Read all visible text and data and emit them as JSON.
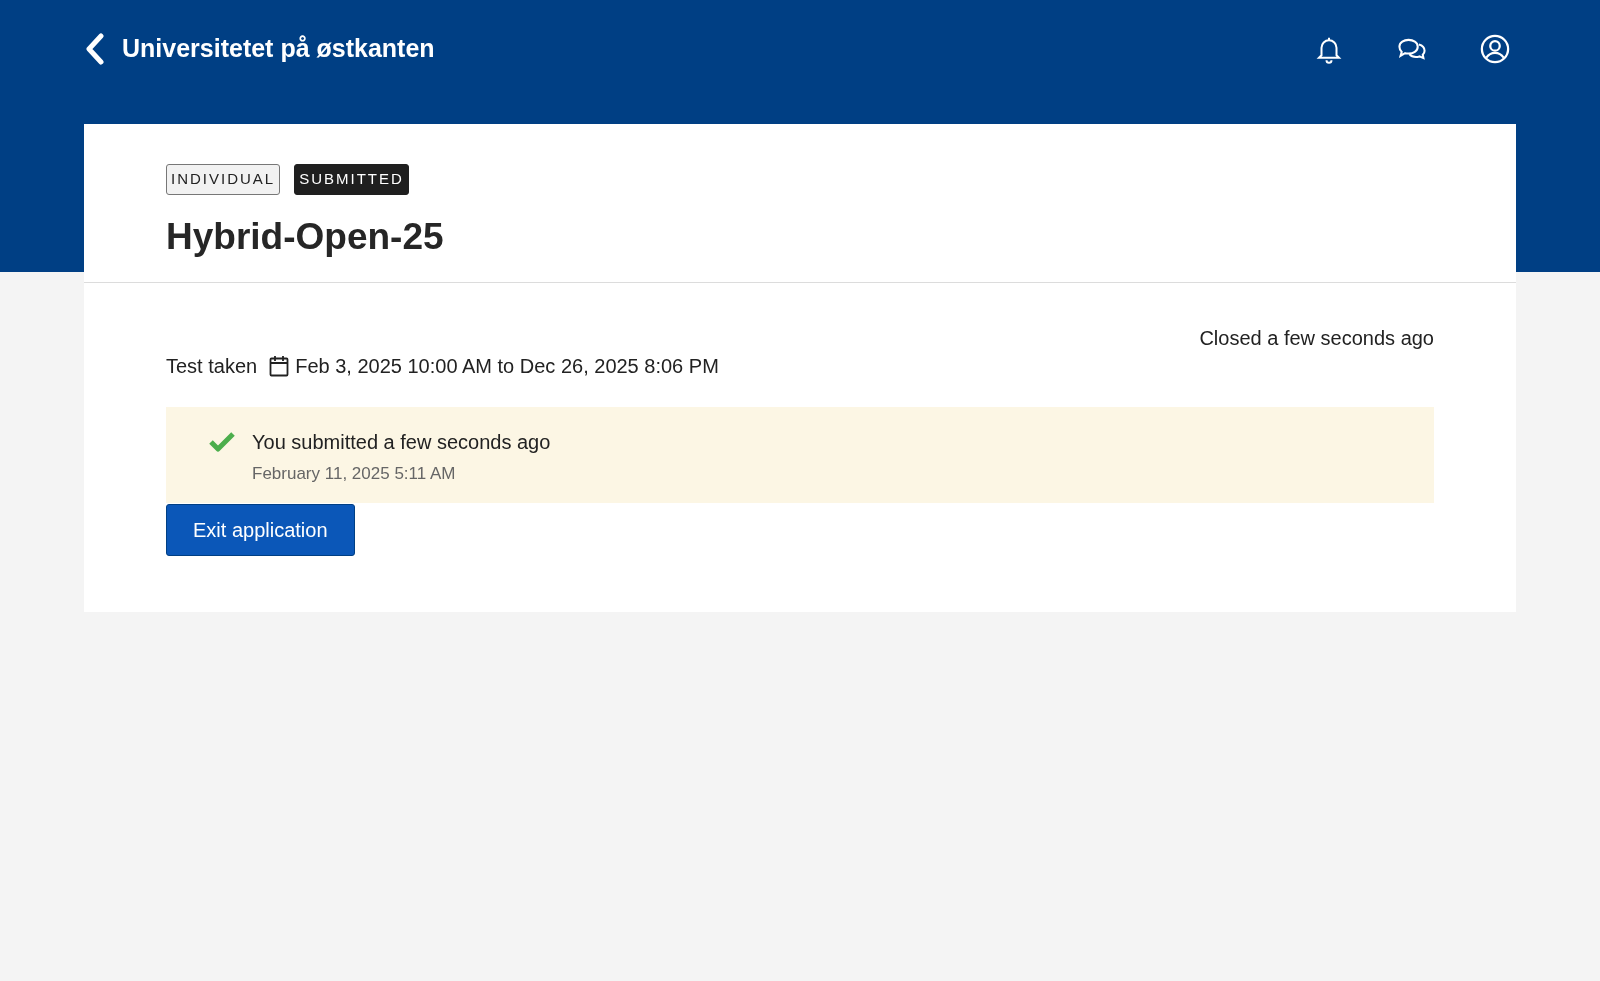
{
  "header": {
    "title": "Universitetet på østkanten"
  },
  "badges": [
    {
      "label": "INDIVIDUAL",
      "kind": "outline"
    },
    {
      "label": "SUBMITTED",
      "kind": "dark"
    }
  ],
  "test": {
    "title": "Hybrid-Open-25",
    "status": "Closed a few seconds ago",
    "label": "Test taken",
    "dates": "Feb 3, 2025 10:00 AM to Dec 26, 2025 8:06 PM"
  },
  "notice": {
    "message": "You submitted a few seconds ago",
    "timestamp": "February 11, 2025 5:11 AM"
  },
  "button": "Exit application"
}
